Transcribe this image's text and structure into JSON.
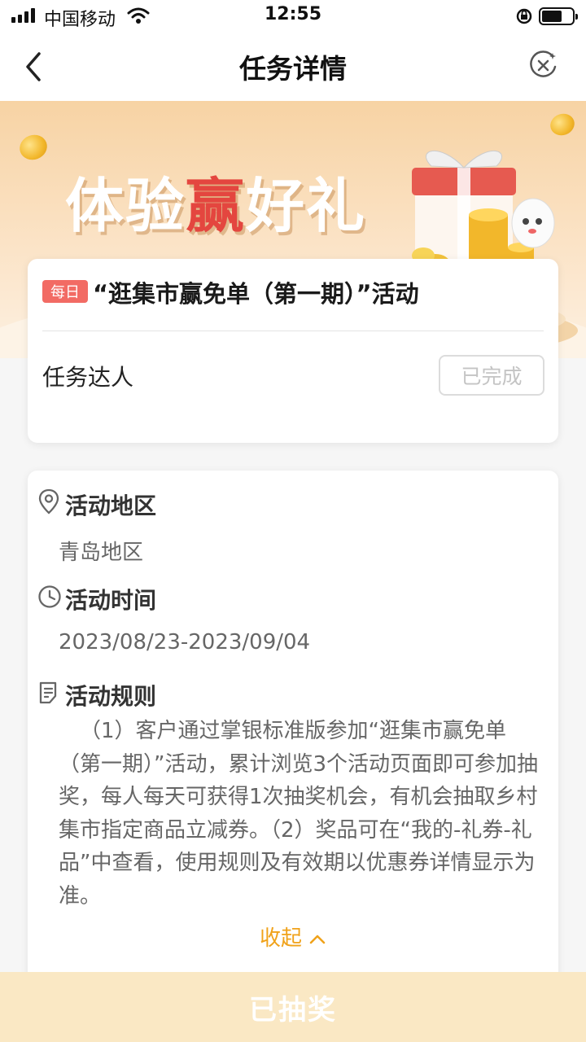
{
  "status_bar": {
    "carrier": "中国移动",
    "time": "12:55"
  },
  "nav": {
    "title": "任务详情",
    "back_icon": "chevron-left-icon",
    "close_icon": "close-circle-icon"
  },
  "banner": {
    "title_part1": "体验",
    "title_highlight": "赢",
    "title_part2": "好礼"
  },
  "task": {
    "badge": "每日",
    "title": "“逛集市赢免单（第一期）”活动",
    "name": "任务达人",
    "status": "已完成"
  },
  "details": {
    "region_title": "活动地区",
    "region_value": "青岛地区",
    "time_title": "活动时间",
    "time_value": "2023/08/23-2023/09/04",
    "rules_title": "活动规则",
    "rules_text": "（1）客户通过掌银标准版参加“逛集市赢免单（第一期）”活动，累计浏览3个活动页面即可参加抽奖，每人每天可获得1次抽奖机会，有机会抽取乡村集市指定商品立减券。（2）奖品可在“我的-礼券-礼品”中查看，使用规则及有效期以优惠券详情显示为准。",
    "collapse_label": "收起"
  },
  "bottom": {
    "button_label": "已抽奖"
  },
  "colors": {
    "badge": "#f26b64",
    "accent": "#f0a21a",
    "highlight": "#e4463f",
    "bottom_bar": "#fae8c4"
  }
}
